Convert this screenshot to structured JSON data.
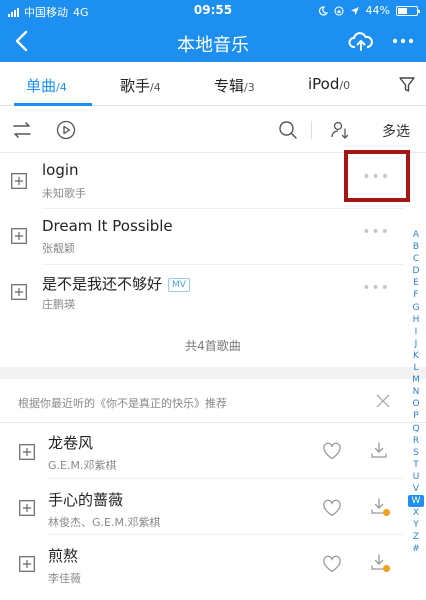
{
  "status_bar": {
    "carrier": "中国移动",
    "network": "4G",
    "time": "09:55",
    "battery": "44%"
  },
  "header": {
    "title": "本地音乐"
  },
  "tabs": [
    {
      "label": "单曲",
      "count": "/4"
    },
    {
      "label": "歌手",
      "count": "/4"
    },
    {
      "label": "专辑",
      "count": "/3"
    },
    {
      "label": "iPod",
      "count": "/0"
    }
  ],
  "toolbar": {
    "multi_select_label": "多选"
  },
  "songs": [
    {
      "title": "login",
      "artist": "未知歌手"
    },
    {
      "title": "Dream It Possible",
      "artist": "张靓颖"
    },
    {
      "title": "是不是我还不够好",
      "artist": "庄鹏瑛",
      "badge": "MV"
    }
  ],
  "total_label": "共4首歌曲",
  "recommend": {
    "header": "根据你最近听的《你不是真正的快乐》推荐",
    "songs": [
      {
        "title": "龙卷风",
        "artist": "G.E.M.邓紫棋"
      },
      {
        "title": "手心的蔷薇",
        "artist": "林俊杰、G.E.M.邓紫棋"
      },
      {
        "title": "煎熬",
        "artist": "李佳薇"
      }
    ]
  },
  "alphabet_index": [
    "A",
    "B",
    "C",
    "D",
    "E",
    "F",
    "G",
    "H",
    "I",
    "J",
    "K",
    "L",
    "M",
    "N",
    "O",
    "P",
    "Q",
    "R",
    "S",
    "T",
    "U",
    "V",
    "W",
    "X",
    "Y",
    "Z",
    "#"
  ],
  "alphabet_selected": "W",
  "colors": {
    "accent": "#1d8ff1",
    "highlight_box": "#a31717"
  }
}
